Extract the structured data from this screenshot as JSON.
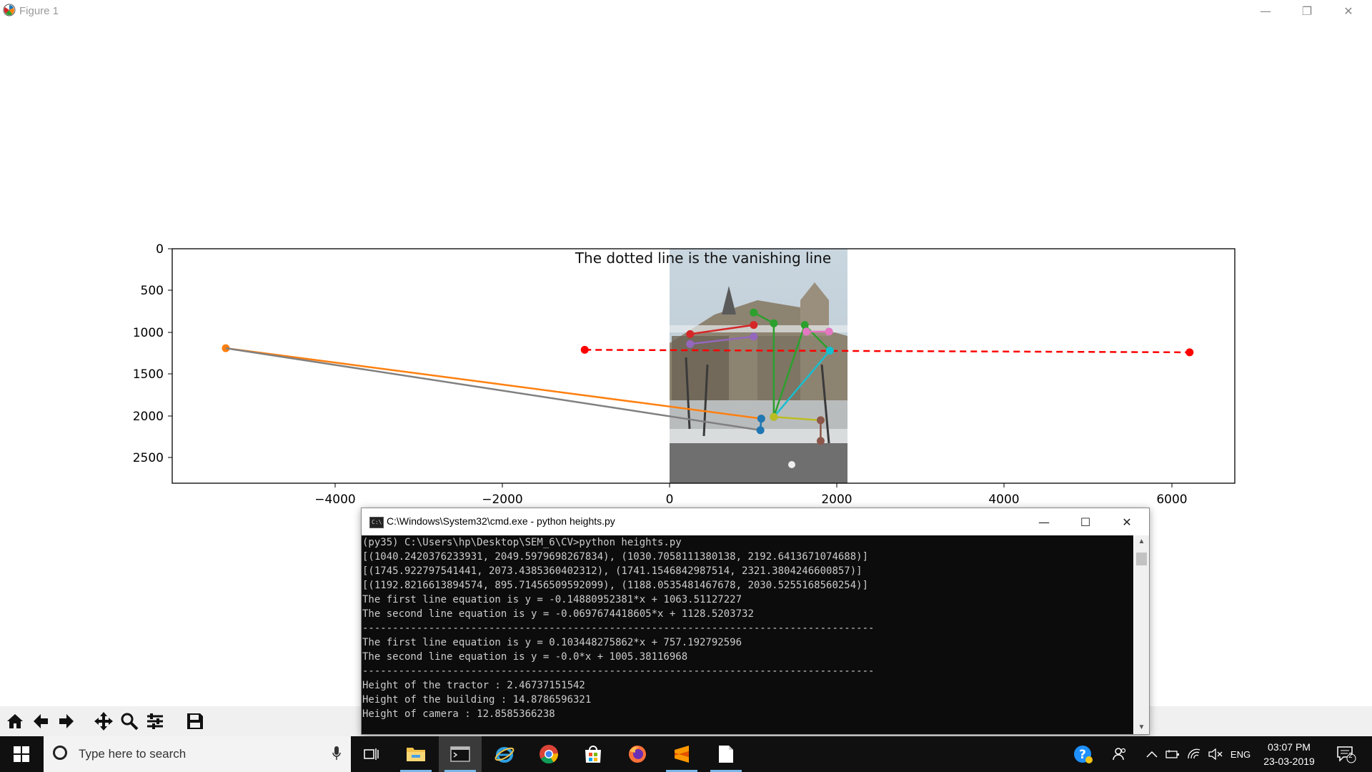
{
  "window": {
    "title": "Figure 1",
    "controls": {
      "minimize": "—",
      "restore": "❐",
      "close": "✕"
    }
  },
  "plot": {
    "title": "The dotted line is the vanishing line",
    "x_ticks": [
      "−4000",
      "−2000",
      "0",
      "2000",
      "4000",
      "6000"
    ],
    "y_ticks": [
      "0",
      "500",
      "1000",
      "1500",
      "2000",
      "2500"
    ],
    "image_label": "building photograph"
  },
  "chart_data": {
    "type": "line",
    "title": "The dotted line is the vanishing line",
    "xlim": [
      -6000,
      6700
    ],
    "ylim": [
      2830,
      0
    ],
    "x_ticks": [
      -4000,
      -2000,
      0,
      2000,
      4000,
      6000
    ],
    "y_ticks": [
      0,
      500,
      1000,
      1500,
      2000,
      2500
    ],
    "grid": false,
    "image_extent": {
      "x": [
        0,
        2120
      ],
      "y": [
        0,
        2830
      ]
    },
    "series": [
      {
        "color": "#ff7f0e",
        "marker": true,
        "dashed": false,
        "points": [
          [
            -5360,
            1200
          ],
          [
            1040,
            2050
          ]
        ]
      },
      {
        "color": "#808080",
        "marker": false,
        "dashed": false,
        "points": [
          [
            -5360,
            1200
          ],
          [
            1030,
            2190
          ]
        ]
      },
      {
        "color": "#ff0000",
        "marker": true,
        "dashed": true,
        "points": [
          [
            -1070,
            1220
          ],
          [
            6160,
            1250
          ]
        ]
      },
      {
        "color": "#2ca02c",
        "marker": true,
        "dashed": false,
        "points": [
          [
            950,
            770
          ],
          [
            1190,
            900
          ],
          [
            1190,
            2030
          ],
          [
            1560,
            920
          ],
          [
            1860,
            1230
          ]
        ]
      },
      {
        "color": "#17becf",
        "marker": true,
        "dashed": false,
        "points": [
          [
            1190,
            2030
          ],
          [
            1860,
            1230
          ]
        ]
      },
      {
        "color": "#d62728",
        "marker": true,
        "dashed": false,
        "points": [
          [
            190,
            1030
          ],
          [
            950,
            920
          ]
        ]
      },
      {
        "color": "#9467bd",
        "marker": true,
        "dashed": false,
        "points": [
          [
            190,
            1150
          ],
          [
            950,
            1060
          ]
        ]
      },
      {
        "color": "#e377c2",
        "marker": true,
        "dashed": false,
        "points": [
          [
            1580,
            1000
          ],
          [
            1850,
            1000
          ]
        ]
      },
      {
        "color": "#bcbd22",
        "marker": true,
        "dashed": false,
        "points": [
          [
            1190,
            2030
          ],
          [
            1750,
            2070
          ]
        ]
      },
      {
        "color": "#8c564b",
        "marker": true,
        "dashed": false,
        "points": [
          [
            1750,
            2070
          ],
          [
            1750,
            2320
          ]
        ]
      },
      {
        "color": "#1f77b4",
        "marker": true,
        "dashed": false,
        "points": [
          [
            1040,
            2050
          ],
          [
            1030,
            2190
          ]
        ]
      }
    ]
  },
  "cmd": {
    "title": "C:\\Windows\\System32\\cmd.exe - python  heights.py",
    "controls": {
      "minimize": "—",
      "maximize": "☐",
      "close": "✕"
    },
    "lines": [
      "(py35) C:\\Users\\hp\\Desktop\\SEM_6\\CV>python heights.py",
      "[(1040.2420376233931, 2049.5979698267834), (1030.7058111380138, 2192.6413671074688)]",
      "[(1745.922797541441, 2073.4385360402312), (1741.1546842987514, 2321.3804246600857)]",
      "[(1192.8216613894574, 895.71456509592099), (1188.0535481467678, 2030.5255168560254)]",
      "The first line equation is y = -0.14880952381*x + 1063.51127227",
      "The second line equation is y = -0.0697674418605*x + 1128.5203732",
      "-------------------------------------------------------------------------------------",
      "The first line equation is y = 0.103448275862*x + 757.192792596",
      "The second line equation is y = -0.0*x + 1005.38116968",
      "-------------------------------------------------------------------------------------",
      "Height of the tractor : 2.46737151542",
      "Height of the building : 14.8786596321",
      "Height of camera : 12.8585366238"
    ]
  },
  "taskbar": {
    "search_placeholder": "Type here to search",
    "language": "ENG",
    "time": "03:07 PM",
    "date": "23-03-2019",
    "notification_count": "2"
  }
}
